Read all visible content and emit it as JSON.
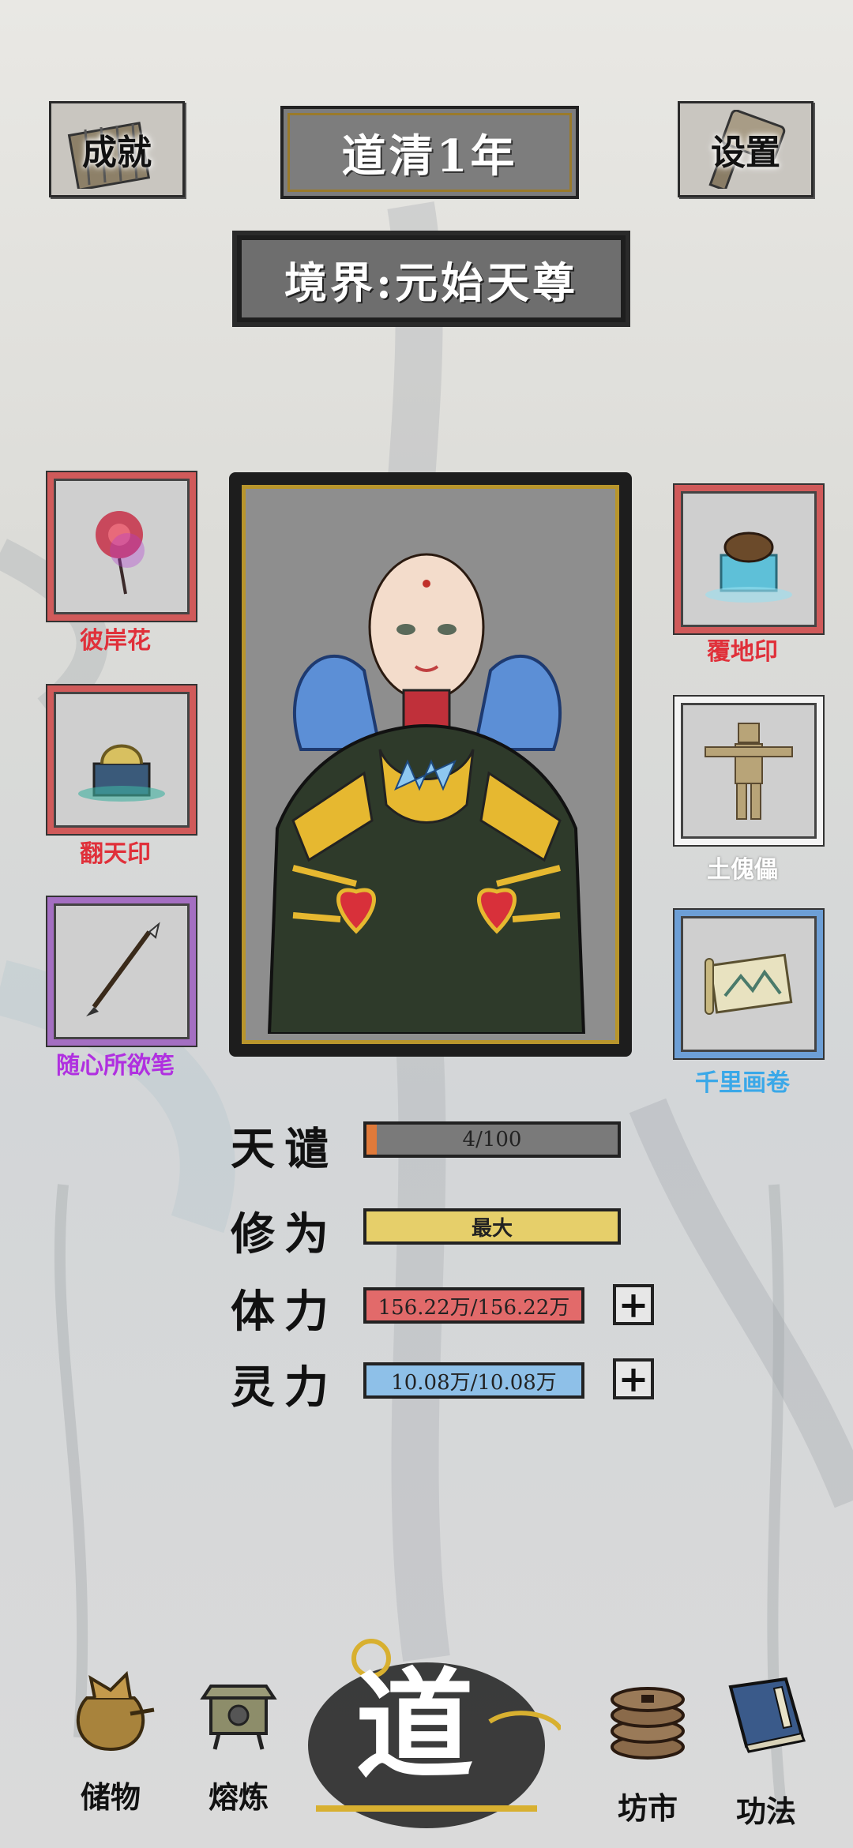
{
  "header": {
    "achievements_label": "成就",
    "year_label": "道清1年",
    "settings_label": "设置"
  },
  "realm": {
    "label": "境界:元始天尊"
  },
  "equipment": {
    "left": [
      {
        "name": "彼岸花",
        "color": "#e0303a"
      },
      {
        "name": "翻天印",
        "color": "#e0303a"
      },
      {
        "name": "随心所欲笔",
        "color": "#b030e0"
      }
    ],
    "right": [
      {
        "name": "覆地印",
        "color": "#e0303a"
      },
      {
        "name": "土傀儡",
        "color": "#ffffff"
      },
      {
        "name": "千里画卷",
        "color": "#3aa8e8"
      }
    ]
  },
  "stats": {
    "tianqian": {
      "label": "天谴",
      "value_text": "4/100",
      "fraction": 0.04,
      "fill_color": "#e07a3a",
      "bar_color": "#7a7a7a"
    },
    "xiuwei": {
      "label": "修为",
      "value_text": "最大",
      "fraction": 1.0,
      "fill_color": "#e6cf6a"
    },
    "tili": {
      "label": "体力",
      "value_text": "156.22万/156.22万",
      "fraction": 1.0,
      "fill_color": "#e26a6a"
    },
    "lingli": {
      "label": "灵力",
      "value_text": "10.08万/10.08万",
      "fraction": 1.0,
      "fill_color": "#8ec0e8"
    }
  },
  "nav": {
    "storage": "储物",
    "smelting": "熔炼",
    "dao": "道",
    "market": "坊市",
    "skills": "功法"
  },
  "icons": {
    "achievements": "bamboo-scroll-icon",
    "settings": "hammer-icon",
    "storage": "pouch-icon",
    "smelting": "furnace-icon",
    "market": "coin-stack-icon",
    "skills": "book-icon"
  }
}
